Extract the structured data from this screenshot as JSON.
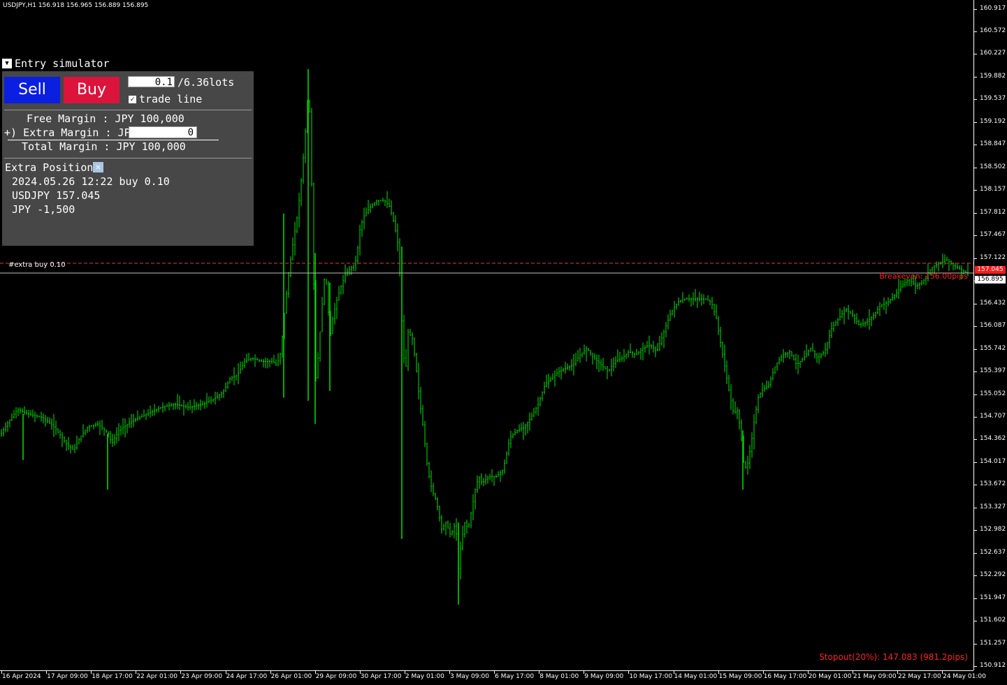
{
  "chart": {
    "symbol_title": "USDJPY,H1  156.918 156.965 156.889 156.895",
    "extra_line_label": "#extra buy 0.10",
    "breakeven_text": "Breakeven: 156.00pips",
    "stopout_text": "Stopout(20%): 147.083 (981.2pips)",
    "extra_price_tag": "157.045",
    "current_price_tag": "156.895",
    "colors": {
      "background": "#000000",
      "bars": "#00e600",
      "extra_line": "#ff3030",
      "bid_line": "#c0c0c0",
      "breakeven_text": "#ff2020",
      "stopout_text": "#ff2020"
    }
  },
  "chart_data": {
    "type": "bar",
    "title": "USDJPY,H1",
    "y_ticks": [
      "160.917",
      "160.572",
      "160.227",
      "159.882",
      "159.537",
      "159.192",
      "158.847",
      "158.502",
      "158.157",
      "157.812",
      "157.467",
      "157.122",
      "156.777",
      "156.432",
      "156.087",
      "155.742",
      "155.397",
      "155.052",
      "154.707",
      "154.362",
      "154.017",
      "153.672",
      "153.327",
      "152.982",
      "152.637",
      "152.292",
      "151.947",
      "151.602",
      "151.257",
      "150.912"
    ],
    "x_ticks": [
      "16 Apr 2024",
      "17 Apr 09:00",
      "18 Apr 17:00",
      "22 Apr 01:00",
      "23 Apr 09:00",
      "24 Apr 17:00",
      "26 Apr 01:00",
      "29 Apr 09:00",
      "30 Apr 17:00",
      "2 May 01:00",
      "3 May 09:00",
      "6 May 17:00",
      "8 May 01:00",
      "9 May 09:00",
      "10 May 17:00",
      "14 May 01:00",
      "15 May 09:00",
      "16 May 17:00",
      "20 May 01:00",
      "21 May 09:00",
      "22 May 17:00",
      "24 May 01:00"
    ],
    "ylim": [
      150.85,
      161.05
    ],
    "price_path": [
      [
        0,
        154.42
      ],
      [
        10,
        154.6
      ],
      [
        25,
        154.82
      ],
      [
        40,
        154.75
      ],
      [
        60,
        154.7
      ],
      [
        75,
        154.58
      ],
      [
        85,
        154.45
      ],
      [
        95,
        154.3
      ],
      [
        105,
        154.2
      ],
      [
        115,
        154.4
      ],
      [
        125,
        154.55
      ],
      [
        140,
        154.6
      ],
      [
        155,
        154.45
      ],
      [
        160,
        154.3
      ],
      [
        170,
        154.5
      ],
      [
        190,
        154.65
      ],
      [
        210,
        154.75
      ],
      [
        230,
        154.85
      ],
      [
        250,
        154.9
      ],
      [
        270,
        154.85
      ],
      [
        290,
        154.9
      ],
      [
        310,
        155.0
      ],
      [
        320,
        155.1
      ],
      [
        330,
        155.3
      ],
      [
        340,
        155.35
      ],
      [
        350,
        155.55
      ],
      [
        360,
        155.6
      ],
      [
        375,
        155.55
      ],
      [
        390,
        155.55
      ],
      [
        396,
        155.5
      ],
      [
        402,
        155.7
      ],
      [
        408,
        156.4
      ],
      [
        414,
        156.95
      ],
      [
        420,
        157.4
      ],
      [
        426,
        157.8
      ],
      [
        432,
        158.4
      ],
      [
        436,
        158.9
      ],
      [
        440,
        159.5
      ],
      [
        444,
        159.3
      ],
      [
        448,
        157.2
      ],
      [
        452,
        155.3
      ],
      [
        456,
        155.7
      ],
      [
        460,
        156.3
      ],
      [
        464,
        156.8
      ],
      [
        468,
        156.7
      ],
      [
        472,
        155.9
      ],
      [
        476,
        156.2
      ],
      [
        480,
        156.4
      ],
      [
        485,
        156.6
      ],
      [
        490,
        156.75
      ],
      [
        495,
        156.9
      ],
      [
        500,
        156.95
      ],
      [
        505,
        157.0
      ],
      [
        510,
        157.1
      ],
      [
        515,
        157.55
      ],
      [
        520,
        157.75
      ],
      [
        530,
        157.9
      ],
      [
        540,
        158.0
      ],
      [
        550,
        158.0
      ],
      [
        558,
        157.9
      ],
      [
        565,
        157.6
      ],
      [
        570,
        157.3
      ],
      [
        573,
        156.7
      ],
      [
        576,
        155.9
      ],
      [
        580,
        155.3
      ],
      [
        584,
        156.0
      ],
      [
        590,
        155.9
      ],
      [
        595,
        155.5
      ],
      [
        600,
        155.0
      ],
      [
        606,
        154.5
      ],
      [
        612,
        153.9
      ],
      [
        618,
        153.6
      ],
      [
        625,
        153.4
      ],
      [
        632,
        153.0
      ],
      [
        638,
        153.1
      ],
      [
        645,
        152.9
      ],
      [
        652,
        153.1
      ],
      [
        656,
        152.4
      ],
      [
        660,
        152.8
      ],
      [
        665,
        153.1
      ],
      [
        670,
        153.0
      ],
      [
        675,
        153.3
      ],
      [
        680,
        153.6
      ],
      [
        685,
        153.8
      ],
      [
        690,
        153.7
      ],
      [
        700,
        153.8
      ],
      [
        710,
        153.8
      ],
      [
        720,
        153.9
      ],
      [
        730,
        154.4
      ],
      [
        740,
        154.5
      ],
      [
        750,
        154.55
      ],
      [
        760,
        154.7
      ],
      [
        770,
        154.9
      ],
      [
        780,
        155.2
      ],
      [
        790,
        155.3
      ],
      [
        800,
        155.4
      ],
      [
        810,
        155.45
      ],
      [
        820,
        155.5
      ],
      [
        830,
        155.65
      ],
      [
        840,
        155.75
      ],
      [
        850,
        155.6
      ],
      [
        860,
        155.5
      ],
      [
        870,
        155.4
      ],
      [
        880,
        155.55
      ],
      [
        890,
        155.6
      ],
      [
        900,
        155.7
      ],
      [
        910,
        155.65
      ],
      [
        920,
        155.75
      ],
      [
        930,
        155.8
      ],
      [
        940,
        155.7
      ],
      [
        950,
        156.0
      ],
      [
        960,
        156.3
      ],
      [
        970,
        156.45
      ],
      [
        980,
        156.5
      ],
      [
        990,
        156.5
      ],
      [
        1000,
        156.5
      ],
      [
        1010,
        156.5
      ],
      [
        1018,
        156.45
      ],
      [
        1025,
        156.2
      ],
      [
        1030,
        155.9
      ],
      [
        1035,
        155.6
      ],
      [
        1040,
        155.3
      ],
      [
        1045,
        155.0
      ],
      [
        1050,
        154.75
      ],
      [
        1055,
        154.8
      ],
      [
        1060,
        154.5
      ],
      [
        1065,
        153.9
      ],
      [
        1070,
        154.0
      ],
      [
        1075,
        154.3
      ],
      [
        1080,
        154.7
      ],
      [
        1085,
        155.0
      ],
      [
        1090,
        155.1
      ],
      [
        1100,
        155.2
      ],
      [
        1110,
        155.5
      ],
      [
        1120,
        155.65
      ],
      [
        1130,
        155.7
      ],
      [
        1140,
        155.5
      ],
      [
        1150,
        155.6
      ],
      [
        1160,
        155.75
      ],
      [
        1170,
        155.6
      ],
      [
        1180,
        155.7
      ],
      [
        1190,
        156.05
      ],
      [
        1200,
        156.2
      ],
      [
        1210,
        156.35
      ],
      [
        1220,
        156.25
      ],
      [
        1230,
        156.1
      ],
      [
        1240,
        156.15
      ],
      [
        1250,
        156.25
      ],
      [
        1260,
        156.4
      ],
      [
        1270,
        156.45
      ],
      [
        1280,
        156.55
      ],
      [
        1290,
        156.7
      ],
      [
        1300,
        156.8
      ],
      [
        1310,
        156.7
      ],
      [
        1320,
        156.75
      ],
      [
        1328,
        156.9
      ],
      [
        1335,
        157.0
      ],
      [
        1345,
        157.05
      ],
      [
        1355,
        157.1
      ],
      [
        1365,
        157.0
      ],
      [
        1375,
        156.95
      ],
      [
        1383,
        156.9
      ]
    ],
    "spikes": [
      [
        406,
        155.0,
        157.8
      ],
      [
        441,
        154.95,
        160.0
      ],
      [
        451,
        154.6,
        157.2
      ],
      [
        472,
        155.1,
        156.75
      ],
      [
        575,
        152.85,
        157.3
      ],
      [
        656,
        151.85,
        153.1
      ],
      [
        1063,
        153.6,
        154.5
      ],
      [
        154,
        153.6,
        154.45
      ],
      [
        33,
        154.05,
        154.75
      ]
    ],
    "extra_buy_price": 157.045,
    "current_price": 156.895
  }
}
